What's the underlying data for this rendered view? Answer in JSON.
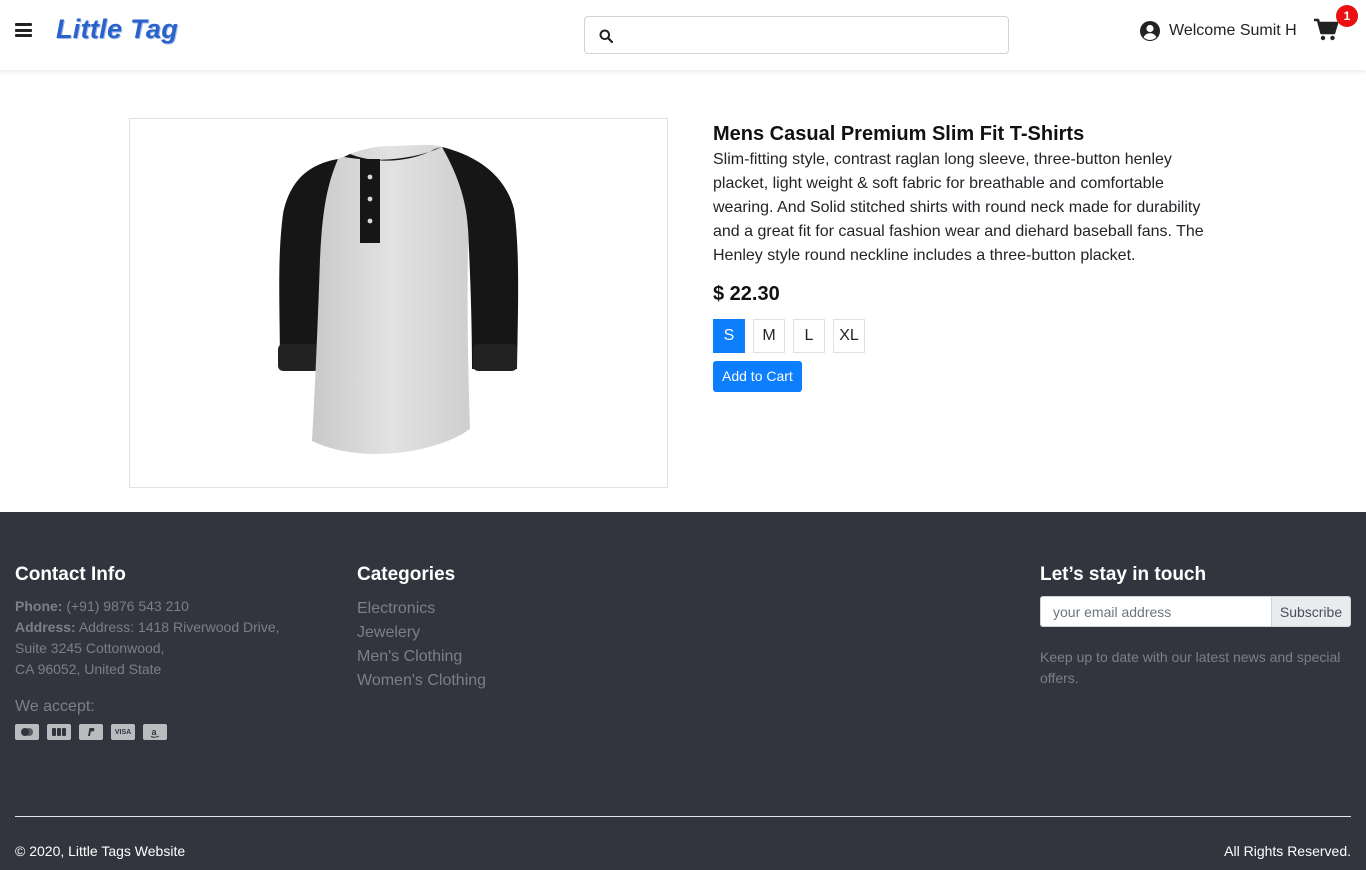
{
  "header": {
    "logo": "Little Tag",
    "search": {
      "value": "",
      "placeholder": ""
    },
    "user_label": "Welcome Sumit H",
    "cart_count": "1"
  },
  "product": {
    "title": "Mens Casual Premium Slim Fit T-Shirts",
    "description": "Slim-fitting style, contrast raglan long sleeve, three-button henley placket, light weight & soft fabric for breathable and comfortable wearing. And Solid stitched shirts with round neck made for durability and a great fit for casual fashion wear and diehard baseball fans. The Henley style round neckline includes a three-button placket.",
    "price": "$ 22.30",
    "sizes": [
      "S",
      "M",
      "L",
      "XL"
    ],
    "selected_size": "S",
    "add_to_cart_label": "Add to Cart"
  },
  "footer": {
    "contact": {
      "heading": "Contact Info",
      "phone_label": "Phone:",
      "phone": "(+91) 9876 543 210",
      "address_label": "Address:",
      "address_line1": "Address: 1418 Riverwood Drive,",
      "address_line2": "Suite 3245 Cottonwood,",
      "address_line3": "CA 96052, United State",
      "we_accept": "We accept:",
      "payment_icons": [
        "mastercard-icon",
        "jcb-icon",
        "paypal-icon",
        "visa-icon",
        "amazon-icon"
      ]
    },
    "categories": {
      "heading": "Categories",
      "items": [
        "Electronics",
        "Jewelery",
        "Men's Clothing",
        "Women's Clothing"
      ]
    },
    "newsletter": {
      "heading": "Let’s stay in touch",
      "email_placeholder": "your email address",
      "subscribe_label": "Subscribe",
      "note": "Keep up to date with our latest news and special offers."
    },
    "copyright": "© 2020, Little Tags Website",
    "rights": "All Rights Reserved."
  },
  "colors": {
    "accent": "#0d7efd",
    "footer_bg": "#32353d",
    "badge": "#ea1010",
    "logo": "#2b62c9"
  }
}
